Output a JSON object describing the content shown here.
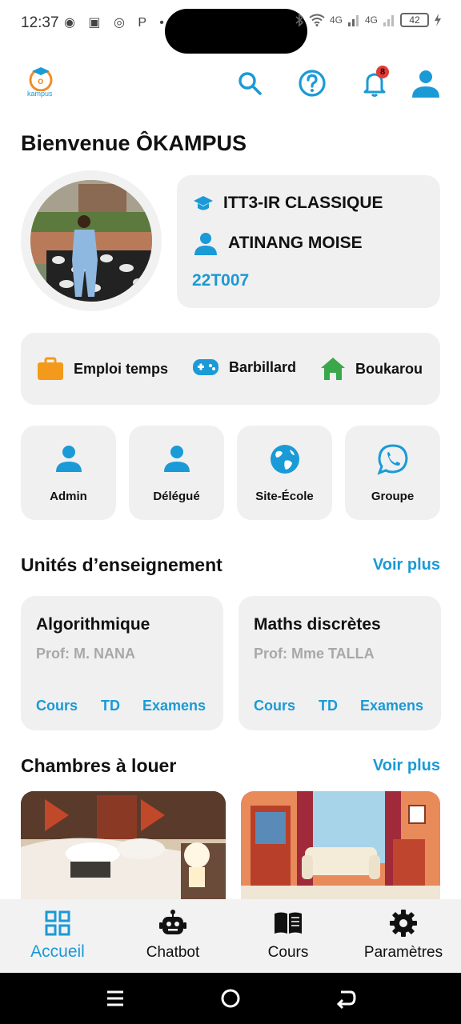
{
  "status_bar": {
    "time": "12:37",
    "notification_icons": "◉ ▣ ◎ P •",
    "network_1": "4G",
    "network_2": "4G",
    "battery": "42"
  },
  "app_bar": {
    "logo_text": "kampus",
    "notification_count": "8"
  },
  "welcome": "Bienvenue ÔKAMPUS",
  "profile": {
    "class": "ITT3-IR CLASSIQUE",
    "name": "ATINANG MOISE",
    "matricule": "22T007"
  },
  "quick_links": [
    {
      "label": "Emploi temps",
      "icon": "briefcase-icon"
    },
    {
      "label": "Barbillard",
      "icon": "gamepad-icon"
    },
    {
      "label": "Boukarou",
      "icon": "house-icon"
    }
  ],
  "tiles": [
    {
      "label": "Admin",
      "icon": "person-icon"
    },
    {
      "label": "Délégué",
      "icon": "person-icon"
    },
    {
      "label": "Site-École",
      "icon": "globe-icon"
    },
    {
      "label": "Groupe",
      "icon": "whatsapp-icon"
    }
  ],
  "units_section": {
    "title": "Unités d’enseignement",
    "see_more": "Voir plus"
  },
  "courses": [
    {
      "title": "Algorithmique",
      "prof": "Prof: M. NANA",
      "links": [
        "Cours",
        "TD",
        "Examens"
      ]
    },
    {
      "title": "Maths discrètes",
      "prof": "Prof: Mme TALLA",
      "links": [
        "Cours",
        "TD",
        "Examens"
      ]
    }
  ],
  "rooms_section": {
    "title": "Chambres à louer",
    "see_more": "Voir plus"
  },
  "bottom_nav": [
    {
      "label": "Accueil",
      "icon": "grid-icon",
      "active": true
    },
    {
      "label": "Chatbot",
      "icon": "robot-icon",
      "active": false
    },
    {
      "label": "Cours",
      "icon": "book-icon",
      "active": false
    },
    {
      "label": "Paramètres",
      "icon": "gear-icon",
      "active": false
    }
  ],
  "colors": {
    "accent": "#1a9ad6",
    "card_background": "#f0f0f0",
    "muted_text": "#a8a8a8",
    "badge": "#e53935"
  }
}
